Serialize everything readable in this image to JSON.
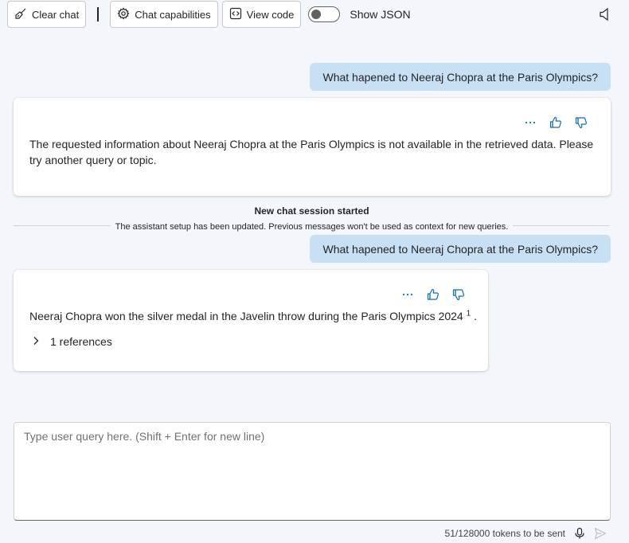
{
  "toolbar": {
    "clear_chat": "Clear chat",
    "chat_capabilities": "Chat capabilities",
    "view_code": "View code",
    "show_json": "Show JSON",
    "show_json_on": false
  },
  "messages": [
    {
      "role": "user",
      "text": "What hapened to Neeraj Chopra at the Paris Olympics?"
    },
    {
      "role": "assistant",
      "text": "The requested information about Neeraj Chopra at the Paris Olympics is not available in the retrieved data. Please try another query or topic."
    }
  ],
  "session_notice": {
    "title": "New chat session started",
    "subtitle": "The assistant setup has been updated. Previous messages won't be used as context for new queries."
  },
  "messages_after": [
    {
      "role": "user",
      "text": "What hapened to Neeraj Chopra at the Paris Olympics?"
    },
    {
      "role": "assistant",
      "text": "Neeraj Chopra won the silver medal in the Javelin throw during the Paris Olympics 2024",
      "citation": "1",
      "citation_suffix": ".",
      "references_label": "1 references"
    }
  ],
  "input": {
    "placeholder": "Type user query here. (Shift + Enter for new line)",
    "value": ""
  },
  "footer": {
    "token_count": "51/128000 tokens to be sent"
  },
  "icons": {
    "clear": "broom-icon",
    "capabilities": "gear-icon",
    "code": "code-icon",
    "speaker": "speaker-icon",
    "more": "more-icon",
    "like": "thumbs-up-icon",
    "dislike": "thumbs-down-icon",
    "expand": "chevron-right-icon",
    "mic": "microphone-icon",
    "send": "send-icon"
  },
  "colors": {
    "user_bubble": "#c7e0f4",
    "accent": "#0f6cbd",
    "background": "#f3f6fb"
  }
}
